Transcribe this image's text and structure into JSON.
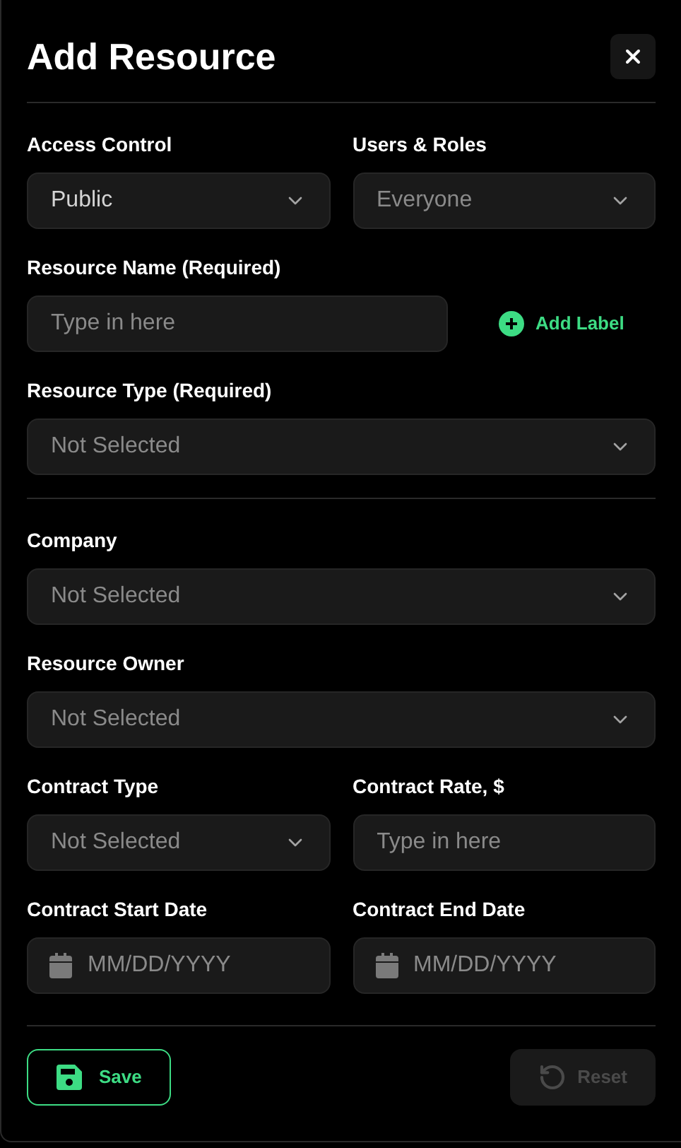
{
  "title": "Add Resource",
  "groups": [
    [
      {
        "fields": [
          {
            "kind": "select",
            "label": "Access Control",
            "value": "Public"
          },
          {
            "kind": "select",
            "label": "Users & Roles",
            "placeholder": "Everyone"
          }
        ]
      },
      {
        "fields": [
          {
            "kind": "text",
            "label": "Resource Name (Required)",
            "placeholder": "Type in here"
          },
          {
            "kind": "action",
            "label": "Add Label"
          }
        ]
      },
      {
        "fields": [
          {
            "kind": "select",
            "label": "Resource Type (Required)",
            "placeholder": "Not Selected"
          }
        ]
      }
    ],
    [
      {
        "fields": [
          {
            "kind": "select",
            "label": "Company",
            "placeholder": "Not Selected"
          }
        ]
      },
      {
        "fields": [
          {
            "kind": "select",
            "label": "Resource Owner",
            "placeholder": "Not Selected"
          }
        ]
      },
      {
        "fields": [
          {
            "kind": "select",
            "label": "Contract Type",
            "placeholder": "Not Selected"
          },
          {
            "kind": "text",
            "label": "Contract Rate, $",
            "placeholder": "Type in here"
          }
        ]
      },
      {
        "fields": [
          {
            "kind": "date",
            "label": "Contract Start Date",
            "placeholder": "MM/DD/YYYY"
          },
          {
            "kind": "date",
            "label": "Contract End Date",
            "placeholder": "MM/DD/YYYY"
          }
        ]
      }
    ]
  ],
  "buttons": [
    {
      "kind": "save",
      "label": "Save",
      "disabled": false
    },
    {
      "kind": "reset",
      "label": "Reset",
      "disabled": true
    }
  ]
}
